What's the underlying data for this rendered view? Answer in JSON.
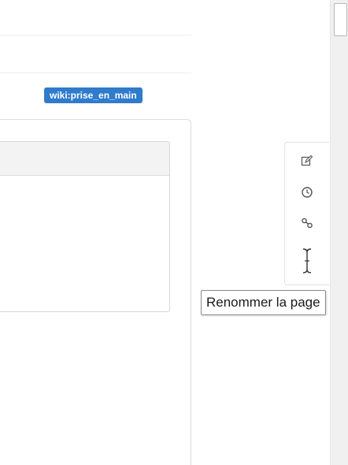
{
  "page": {
    "id_badge": "wiki:prise_en_main"
  },
  "page_tools": {
    "items": [
      {
        "name": "edit",
        "icon": "edit-icon"
      },
      {
        "name": "history",
        "icon": "clock-icon"
      },
      {
        "name": "backlinks",
        "icon": "link-icon"
      },
      {
        "name": "rename",
        "icon": "text-cursor-icon"
      }
    ]
  },
  "tooltip": {
    "text": "Renommer la page"
  },
  "colors": {
    "badge_bg": "#2f7bcc",
    "badge_text": "#ffffff",
    "icon": "#555555"
  }
}
